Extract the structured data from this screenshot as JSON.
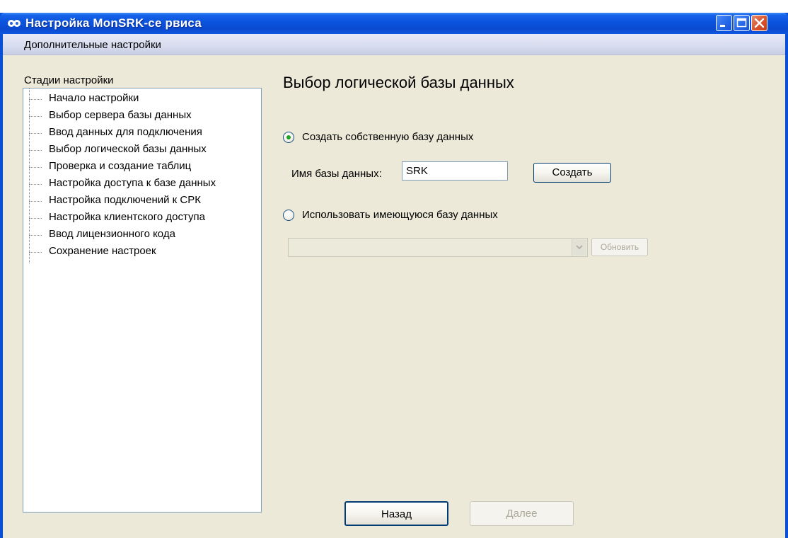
{
  "window": {
    "title": "Настройка MonSRK-се рвиса"
  },
  "menubar": {
    "items": [
      "Дополнительные настройки"
    ]
  },
  "sidebar": {
    "heading": "Стадии настройки",
    "items": [
      "Начало настройки",
      "Выбор сервера базы данных",
      "Ввод данных для подключения",
      "Выбор логической базы данных",
      "Проверка и создание таблиц",
      "Настройка доступа к базе данных",
      "Настройка подключений к СРК",
      "Настройка клиентского доступа",
      "Ввод лицензионного кода",
      "Сохранение настроек"
    ]
  },
  "main": {
    "title": "Выбор логической базы данных",
    "option_create": {
      "label": "Создать собственную базу данных",
      "selected": true
    },
    "db_name_label": "Имя базы данных:",
    "db_name_value": "SRK",
    "create_button": "Создать",
    "option_existing": {
      "label": "Использовать имеющуюся базу данных",
      "selected": false
    },
    "existing_db_selected": "",
    "refresh_button": "Обновить"
  },
  "footer": {
    "back_button": "Назад",
    "next_button": "Далее"
  },
  "colors": {
    "titlebar": "#0a4fd8",
    "client_bg": "#ece9d8",
    "radio_dot": "#21a121",
    "close_button": "#d9532d"
  }
}
